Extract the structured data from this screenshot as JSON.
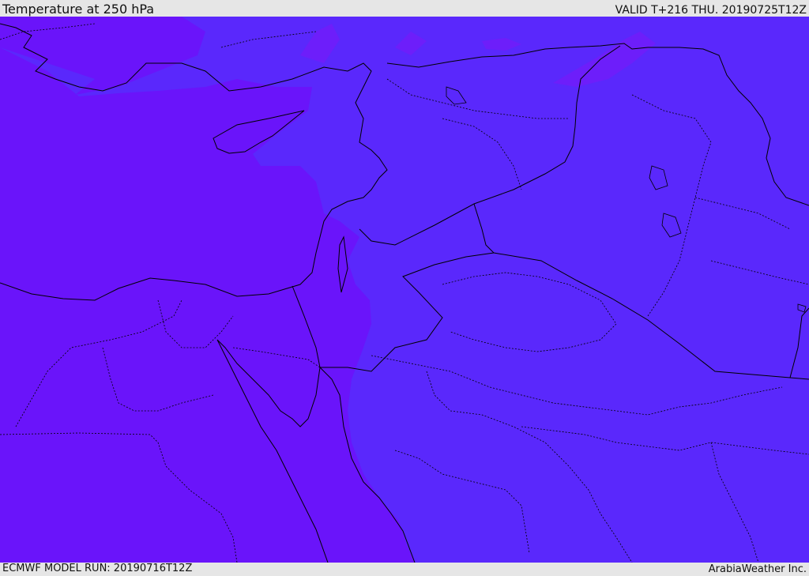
{
  "header": {
    "title": "Temperature at 250 hPa",
    "valid": "VALID T+216 THU. 20190725T12Z"
  },
  "footer": {
    "model_run": "ECMWF MODEL RUN: 20190716T12Z",
    "credit": "ArabiaWeather Inc."
  },
  "colors": {
    "warm_band": "#6a14fa",
    "cool_band": "#5a28fc",
    "cold_patch": "#6d1efa",
    "border_line": "#000000",
    "background": "#e6e6e6"
  }
}
